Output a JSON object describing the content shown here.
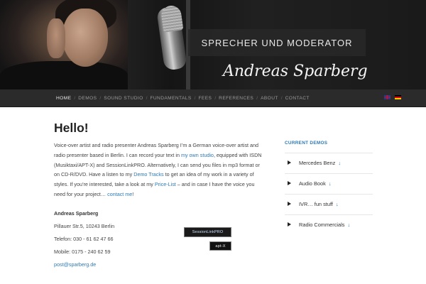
{
  "header": {
    "headline": "SPRECHER UND MODERATOR",
    "signature": "Andreas Sparberg"
  },
  "nav": {
    "items": [
      "HOME",
      "DEMOS",
      "SOUND STUDIO",
      "FUNDAMENTALS",
      "FEES",
      "REFERENCES",
      "ABOUT",
      "CONTACT"
    ],
    "active": "HOME",
    "separator": "/",
    "flags": [
      "uk-flag-icon",
      "de-flag-icon"
    ]
  },
  "main": {
    "title": "Hello!",
    "intro": {
      "p1": "Voice-over artist and radio presenter Andreas Sparberg I’m a German voice-over artist and radio presenter based in Berlin. I can record your text in ",
      "link1": "my own studio",
      "p2": ", equipped with ISDN (Musiktaxi/APT-X) and SessionLinkPRO. Alternatively, I can send you files in mp3 format or on CD-R/DVD. Have a listen to my ",
      "link2": "Demo Tracks",
      "p3": " to get an idea of my work in a variety of styles. If you’re interested, take a look at my ",
      "link3": "Price-List",
      "p4": " – and in case I have the voice you need for your project… ",
      "link4": "contact me",
      "p5": "!"
    },
    "contact": {
      "name": "Andreas Sparberg",
      "address": "Pillauer Str.5, 10243 Berlin",
      "phone": "Telefon: 030 - 61 62 47 66",
      "mobile": "Mobile: 0175 - 240 62 59",
      "email": "post@sparberg.de"
    },
    "badges": {
      "sessionlink": "SessionLinkPRO",
      "aptx": "apt-X"
    }
  },
  "sidebar": {
    "title": "CURRENT DEMOS",
    "demos": [
      {
        "label": "Mercedes Benz",
        "icon": "download-arrow-icon"
      },
      {
        "label": "Audio Book",
        "icon": "download-arrow-icon"
      },
      {
        "label": "IVR… fun stuff",
        "icon": "download-arrow-icon"
      },
      {
        "label": "Radio Commercials",
        "icon": "download-arrow-icon"
      }
    ],
    "download_glyph": "↓"
  },
  "colors": {
    "link": "#2d7ab5",
    "nav_bg": "#2b2b2b",
    "header_bg": "#1a1a1a"
  }
}
